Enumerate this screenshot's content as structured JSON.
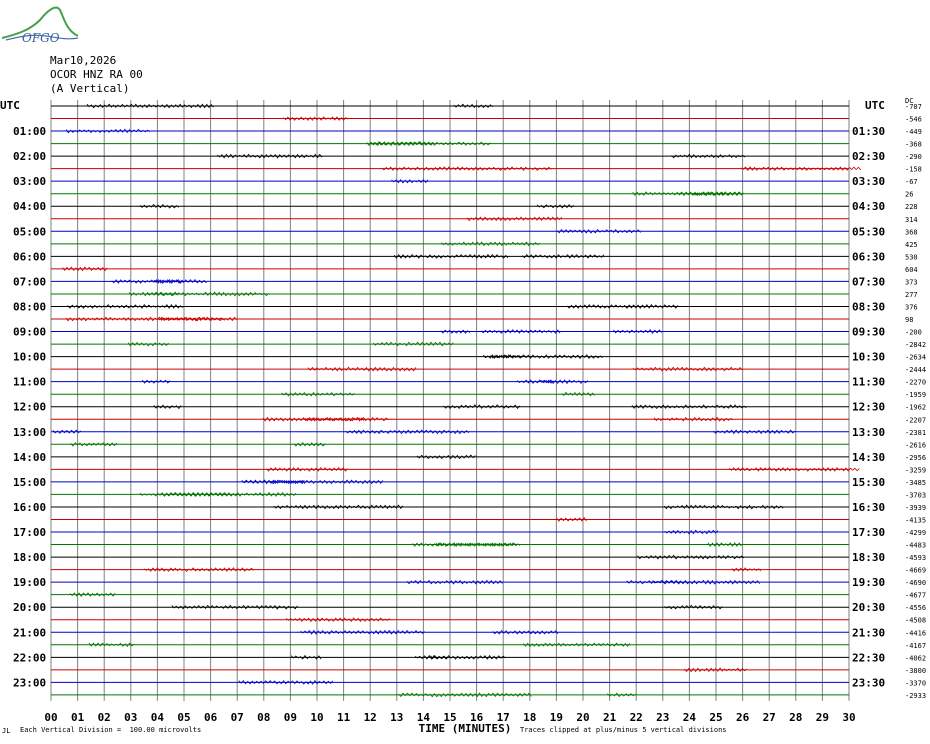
{
  "logo_text": "OFGO",
  "header": {
    "date": "Mar10,2026",
    "station": "OCOR HNZ RA 00",
    "component": "(A Vertical)"
  },
  "chart_data": {
    "type": "helicorder",
    "left_axis_title": "UTC",
    "right_axis_title": "UTC",
    "dc_label": "DC",
    "left_labels": [
      "01:00",
      "02:00",
      "03:00",
      "04:00",
      "05:00",
      "06:00",
      "07:00",
      "08:00",
      "09:00",
      "10:00",
      "11:00",
      "12:00",
      "13:00",
      "14:00",
      "15:00",
      "16:00",
      "17:00",
      "18:00",
      "19:00",
      "20:00",
      "21:00",
      "22:00",
      "23:00"
    ],
    "right_labels": [
      "01:30",
      "02:30",
      "03:30",
      "04:30",
      "05:30",
      "06:30",
      "07:30",
      "08:30",
      "09:30",
      "10:30",
      "11:30",
      "12:30",
      "13:30",
      "14:30",
      "15:30",
      "16:30",
      "17:30",
      "18:30",
      "19:30",
      "20:30",
      "21:30",
      "22:30",
      "23:30"
    ],
    "dc_offsets": [
      "-707",
      "-546",
      "-449",
      "-368",
      "-290",
      "-158",
      "-67",
      "26",
      "228",
      "314",
      "368",
      "425",
      "530",
      "604",
      "373",
      "277",
      "376",
      "98",
      "-200",
      "-2842",
      "-2634",
      "-2444",
      "-2270",
      "-1959",
      "-1962",
      "-2207",
      "-2381",
      "-2616",
      "-2956",
      "-3259",
      "-3485",
      "-3703",
      "-3939",
      "-4135",
      "-4299",
      "-4483",
      "-4593",
      "-4669",
      "-4690",
      "-4677",
      "-4556",
      "-4508",
      "-4416",
      "-4167",
      "-4062",
      "-3800",
      "-3370",
      "-2933"
    ],
    "x_ticks": [
      "00",
      "01",
      "02",
      "03",
      "04",
      "05",
      "06",
      "07",
      "08",
      "09",
      "10",
      "11",
      "12",
      "13",
      "14",
      "15",
      "16",
      "17",
      "18",
      "19",
      "20",
      "21",
      "22",
      "23",
      "24",
      "25",
      "26",
      "27",
      "28",
      "29",
      "30"
    ],
    "xlabel": "TIME (MINUTES)",
    "trace_colors": [
      "#000000",
      "#cc0000",
      "#0000cc",
      "#007700"
    ],
    "grid_color": "#808080",
    "xlim": [
      0,
      30
    ]
  },
  "footer": {
    "scale_note": "Each Vertical Division =  100.00 microvolts",
    "clip_note": "Traces clipped at plus/minus 5 vertical divisions",
    "corner_mark": "JL"
  }
}
